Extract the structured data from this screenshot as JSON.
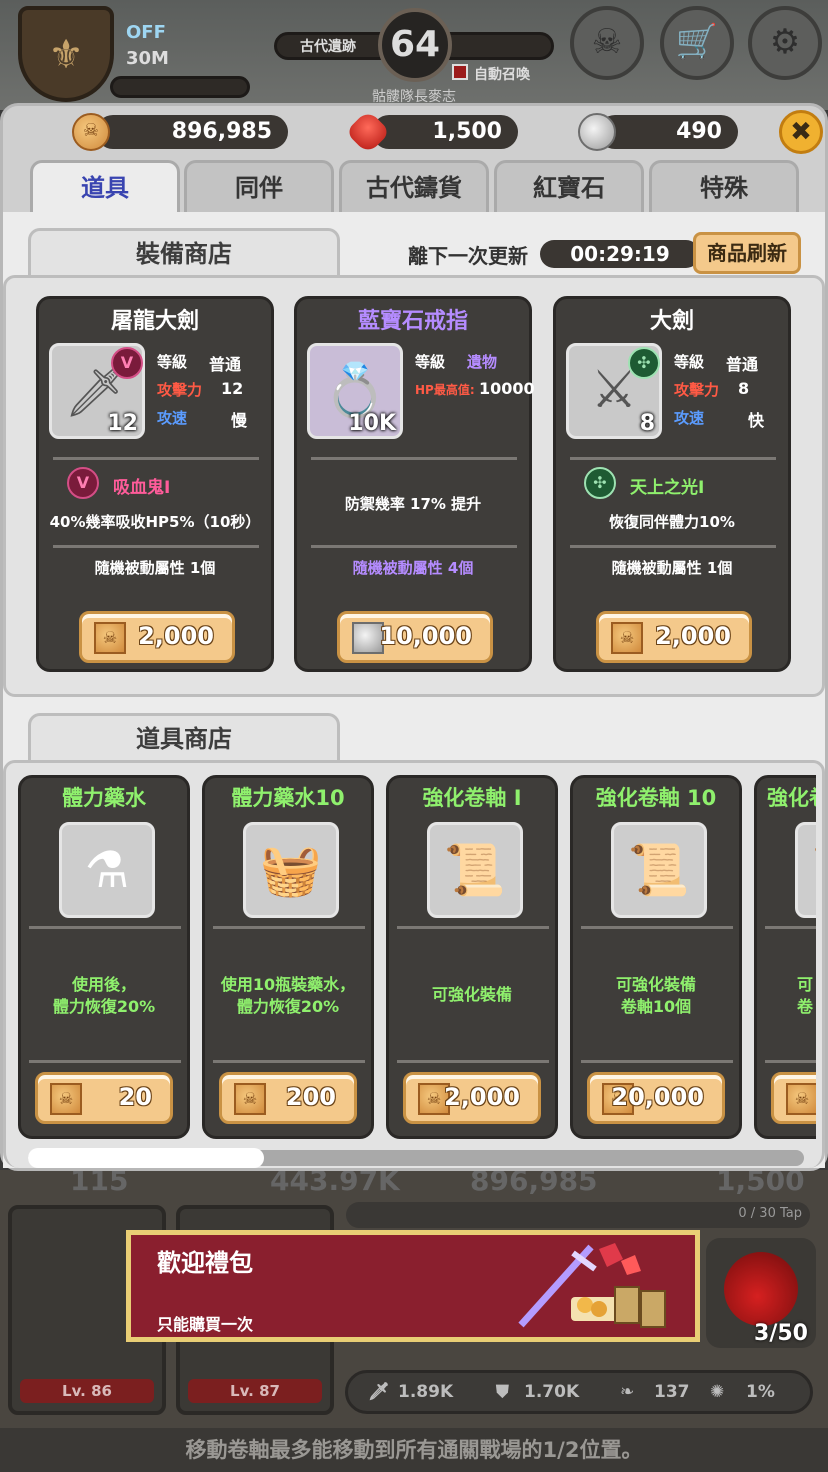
{
  "hud": {
    "off_label": "OFF",
    "off_time": "30M",
    "level": "64",
    "stage_name": "古代遺跡",
    "auto_summon": "自動召喚",
    "boss_name": "骷髏隊長麥志",
    "icon_skull": "skull-icon",
    "icon_shop": "shop-cart-icon",
    "icon_settings": "gear-icon"
  },
  "resources": {
    "gold": "896,985",
    "ruby": "1,500",
    "silver": "490"
  },
  "close_label": "✖",
  "tabs": [
    "道具",
    "同伴",
    "古代鑄貨",
    "紅寶石",
    "特殊"
  ],
  "active_tab": 0,
  "equipment_shop": {
    "title": "裝備商店",
    "refresh_label": "離下一次更新",
    "timer": "00:29:19",
    "refresh_button": "商品刷新",
    "items": [
      {
        "name": "屠龍大劍",
        "name_color": "#ffffff",
        "level": "12",
        "grade_label": "等級",
        "grade": "普通",
        "stat1_label": "攻擊力",
        "stat1_value": "12",
        "stat2_label": "攻速",
        "stat2_value": "慢",
        "skill_name": "吸血鬼Ⅰ",
        "skill_desc": "40%幾率吸收HP5%（10秒）",
        "random_attr": "隨機被動屬性 1個",
        "price": "2,000",
        "currency": "gold"
      },
      {
        "name": "藍寶石戒指",
        "name_color": "#b58cff",
        "level": "10K",
        "grade_label": "等級",
        "grade": "遺物",
        "stat1_label": "HP最高值:",
        "stat1_value": "10000",
        "skill_desc": "防禦幾率 17% 提升",
        "random_attr": "隨機被動屬性 4個",
        "price": "10,000",
        "currency": "silver"
      },
      {
        "name": "大劍",
        "name_color": "#ffffff",
        "level": "8",
        "grade_label": "等級",
        "grade": "普通",
        "stat1_label": "攻擊力",
        "stat1_value": "8",
        "stat2_label": "攻速",
        "stat2_value": "快",
        "skill_name": "天上之光Ⅰ",
        "skill_desc": "恢復同伴體力10%",
        "random_attr": "隨機被動屬性 1個",
        "price": "2,000",
        "currency": "gold"
      }
    ]
  },
  "item_shop": {
    "title": "道具商店",
    "items": [
      {
        "name": "體力藥水",
        "desc1": "使用後，",
        "desc2": "體力恢復20%",
        "price": "20"
      },
      {
        "name": "體力藥水10",
        "desc1": "使用10瓶裝藥水，",
        "desc2": "體力恢復20%",
        "price": "200"
      },
      {
        "name": "強化卷軸 I",
        "desc1": "可強化裝備",
        "desc2": "",
        "price": "2,000"
      },
      {
        "name": "強化卷軸 10",
        "desc1": "可強化裝備",
        "desc2": "卷軸10個",
        "price": "20,000"
      },
      {
        "name": "強化卷",
        "desc1": "可",
        "desc2": "卷",
        "price": ""
      }
    ]
  },
  "bottom": {
    "hero1_level": "Lv. 86",
    "hero2_level": "Lv. 87",
    "tap_progress": "0 / 30 Tap",
    "stat_attack": "1.89K",
    "stat_defense": "1.70K",
    "stat_speed": "137",
    "stat_crit": "1%",
    "potion_count": "3/50",
    "bg_gold": "896,985",
    "bg_ruby": "1,500",
    "bg_gem": "443.97K",
    "bg_item": "115",
    "tip": "移動卷軸最多能移動到所有通關戰場的1/2位置。"
  },
  "banner": {
    "title": "歡迎禮包",
    "subtitle": "只能購買一次"
  },
  "colors": {
    "accent_tab": "#3944b0",
    "skill_vamp": "#ff5c9a",
    "skill_light": "#8ff06d",
    "item_green": "#8ff06d",
    "stat_red": "#ff5a45",
    "stat_blue": "#5b9cff",
    "relic_purple": "#b58cff"
  }
}
